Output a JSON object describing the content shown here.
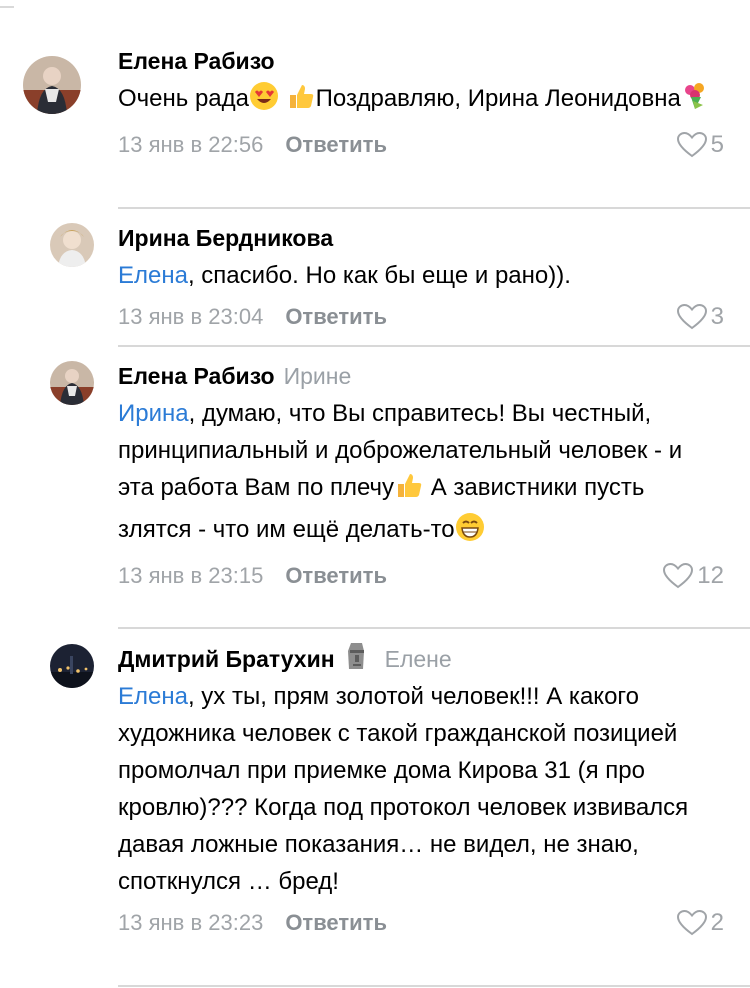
{
  "comments": [
    {
      "author": "Елена Рабизо",
      "reply_to": "",
      "text_parts": [
        "Очень рада",
        " ",
        "Поздравляю, Ирина Леонидовна"
      ],
      "emojis": [
        "heart-eyes-face",
        "thumbs-up",
        "bouquet"
      ],
      "time": "13 янв в 22:56",
      "reply_label": "Ответить",
      "likes": "5"
    },
    {
      "author": "Ирина Бердникова",
      "reply_to": "",
      "mention": "Елена",
      "text": ", спасибо. Но как бы еще и рано)).",
      "time": "13 янв в 23:04",
      "reply_label": "Ответить",
      "likes": "3"
    },
    {
      "author": "Елена Рабизо",
      "reply_to": "Ирине",
      "mention": "Ирина",
      "text_a": ", думаю, что Вы справитесь! Вы честный, принципиальный и доброжелательный человек - и эта работа Вам по плечу",
      "text_b": " А завистники пусть злятся - что им ещё делать-то",
      "emojis": [
        "thumbs-up",
        "grinning-face"
      ],
      "time": "13 янв в 23:15",
      "reply_label": "Ответить",
      "likes": "12"
    },
    {
      "author": "Дмитрий Братухин",
      "author_badge": "moai-emoji",
      "reply_to": "Елене",
      "mention": "Елена",
      "text": ", ух ты, прям золотой человек!!! А какого художника человек с такой гражданской позицией промолчал при приемке дома Кирова 31 (я про кровлю)??? Когда под протокол человек извивался давая ложные показания… не видел, не знаю, споткнулся … бред!",
      "time": "13 янв в 23:23",
      "reply_label": "Ответить",
      "likes": "2"
    }
  ],
  "colors": {
    "mention": "#2b7bd6",
    "meta": "#a0a4a8",
    "separator": "#d8d8d8"
  }
}
